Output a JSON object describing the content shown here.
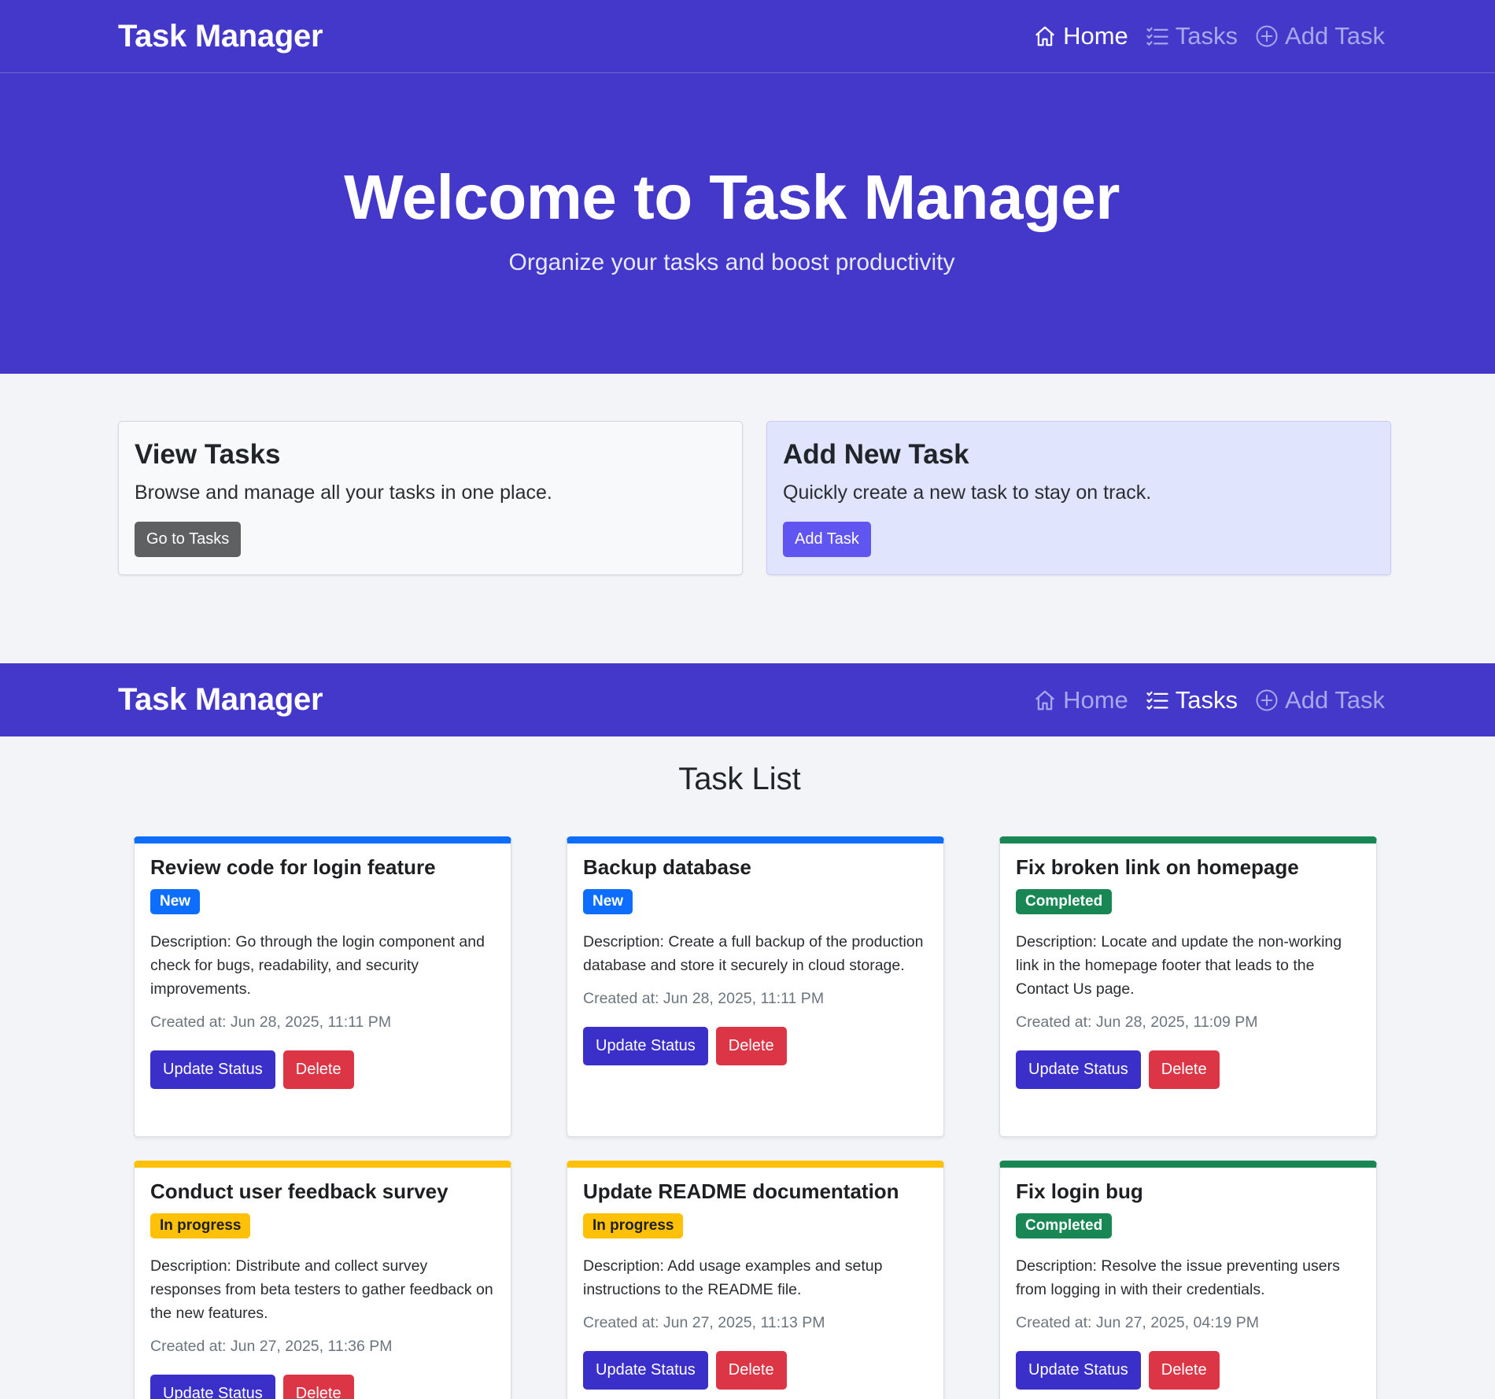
{
  "nav": {
    "brand": "Task Manager",
    "links": [
      {
        "label": "Home",
        "icon": "home-icon"
      },
      {
        "label": "Tasks",
        "icon": "list-icon"
      },
      {
        "label": "Add Task",
        "icon": "plus-circle-icon"
      }
    ]
  },
  "hero": {
    "title": "Welcome to Task Manager",
    "subtitle": "Organize your tasks and boost productivity"
  },
  "features": [
    {
      "title": "View Tasks",
      "text": "Browse and manage all your tasks in one place.",
      "button": "Go to Tasks"
    },
    {
      "title": "Add New Task",
      "text": "Quickly create a new task to stay on track.",
      "button": "Add Task"
    }
  ],
  "tasks_page": {
    "title": "Task List",
    "update_label": "Update Status",
    "delete_label": "Delete",
    "tasks": [
      {
        "title": "Review code for login feature",
        "status": "New",
        "description": "Description: Go through the login component and check for bugs, readability, and security improvements.",
        "created": "Created at: Jun 28, 2025, 11:11 PM"
      },
      {
        "title": "Backup database",
        "status": "New",
        "description": "Description: Create a full backup of the production database and store it securely in cloud storage.",
        "created": "Created at: Jun 28, 2025, 11:11 PM"
      },
      {
        "title": "Fix broken link on homepage",
        "status": "Completed",
        "description": "Description: Locate and update the non-working link in the homepage footer that leads to the Contact Us page.",
        "created": "Created at: Jun 28, 2025, 11:09 PM"
      },
      {
        "title": "Conduct user feedback survey",
        "status": "In progress",
        "description": "Description: Distribute and collect survey responses from beta testers to gather feedback on the new features.",
        "created": "Created at: Jun 27, 2025, 11:36 PM"
      },
      {
        "title": "Update README documentation",
        "status": "In progress",
        "description": "Description: Add usage examples and setup instructions to the README file.",
        "created": "Created at: Jun 27, 2025, 11:13 PM"
      },
      {
        "title": "Fix login bug",
        "status": "Completed",
        "description": "Description: Resolve the issue preventing users from logging in with their credentials.",
        "created": "Created at: Jun 27, 2025, 04:19 PM"
      }
    ]
  },
  "colors": {
    "primary": "#4338ca",
    "status_new": "#0d6efd",
    "status_progress": "#ffc107",
    "status_done": "#198754",
    "danger": "#dc3545"
  }
}
